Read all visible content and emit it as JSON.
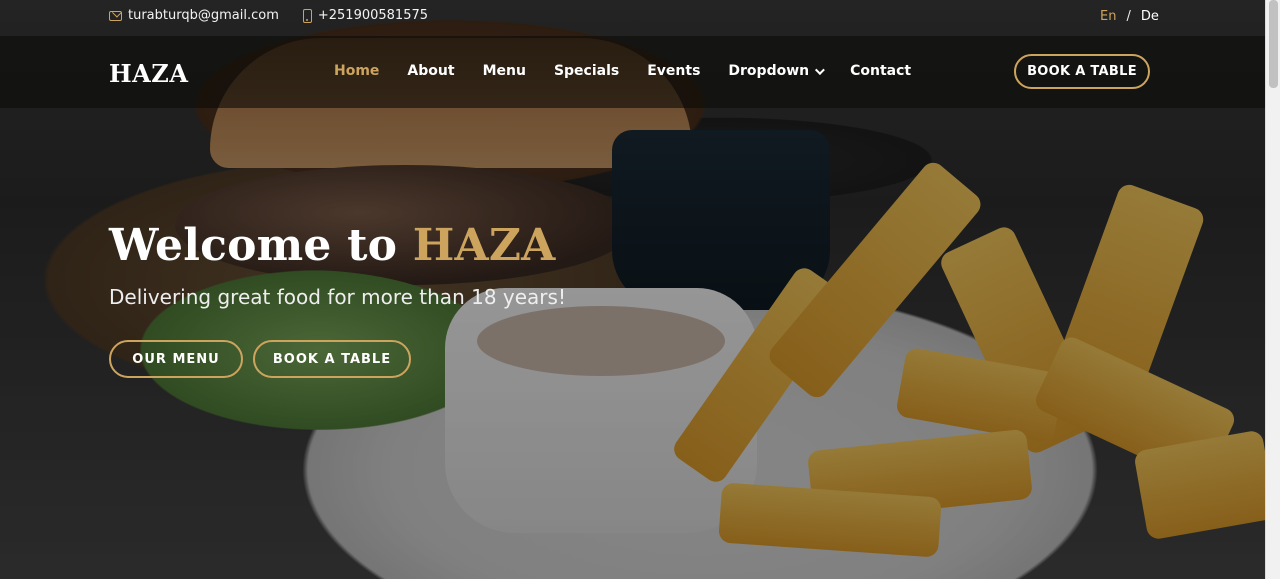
{
  "topbar": {
    "email": "turabturqb@gmail.com",
    "phone": "+251900581575",
    "lang": {
      "active": "En",
      "separator": "/",
      "other": "De"
    }
  },
  "nav": {
    "logo": "HAZA",
    "items": [
      {
        "label": "Home",
        "active": true
      },
      {
        "label": "About"
      },
      {
        "label": "Menu"
      },
      {
        "label": "Specials"
      },
      {
        "label": "Events"
      },
      {
        "label": "Dropdown"
      },
      {
        "label": "Contact"
      }
    ],
    "cta": "BOOK A TABLE"
  },
  "hero": {
    "title_prefix": "Welcome to ",
    "title_brand": "HAZA",
    "subtitle": "Delivering great food for more than 18 years!",
    "buttons": {
      "menu": "OUR MENU",
      "book": "BOOK A TABLE"
    }
  },
  "colors": {
    "accent": "#cda45e",
    "nav_bg": "#0c0b09"
  },
  "icons": {
    "email": "mail-icon",
    "phone": "phone-icon",
    "dropdown": "chevron-down-icon"
  }
}
